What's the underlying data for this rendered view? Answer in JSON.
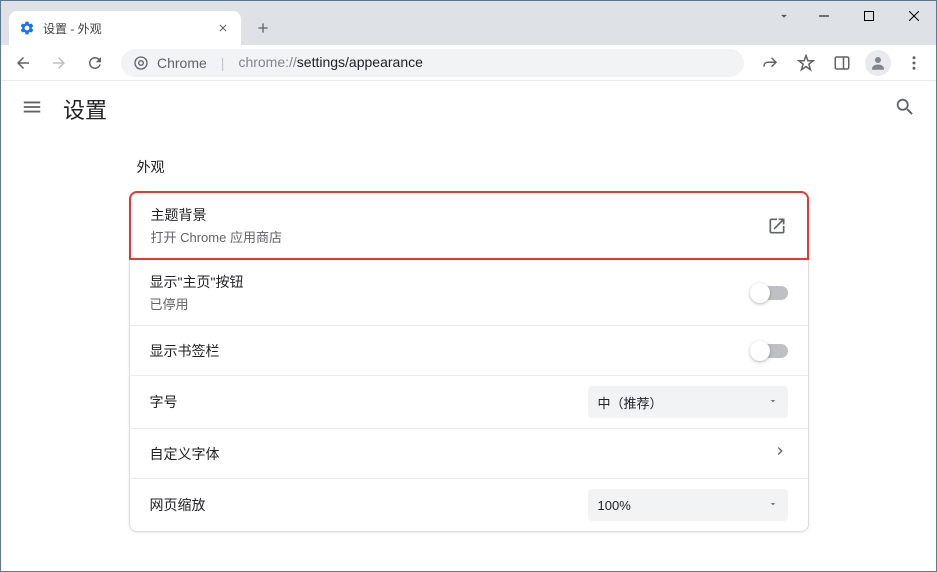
{
  "window": {
    "tab_title": "设置 - 外观"
  },
  "omnibox": {
    "chrome_label": "Chrome",
    "url_prefix": "chrome://",
    "url_path": "settings/appearance"
  },
  "header": {
    "title": "设置"
  },
  "section": {
    "label": "外观"
  },
  "rows": {
    "theme": {
      "title": "主题背景",
      "subtitle": "打开 Chrome 应用商店"
    },
    "home_button": {
      "title": "显示\"主页\"按钮",
      "subtitle": "已停用",
      "enabled": false
    },
    "bookmarks_bar": {
      "title": "显示书签栏",
      "enabled": false
    },
    "font_size": {
      "title": "字号",
      "value": "中（推荐）"
    },
    "custom_fonts": {
      "title": "自定义字体"
    },
    "page_zoom": {
      "title": "网页缩放",
      "value": "100%"
    }
  }
}
